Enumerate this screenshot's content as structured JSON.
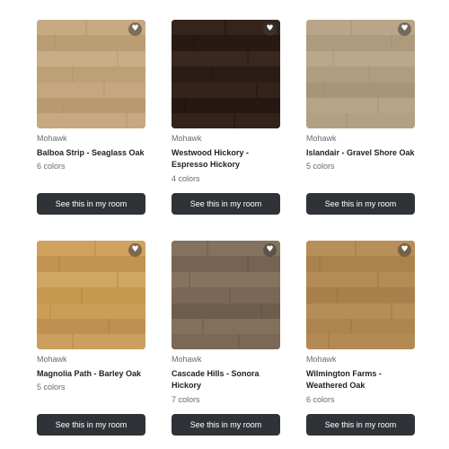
{
  "products": [
    {
      "brand": "Mohawk",
      "name": "Balboa Strip - Seaglass Oak",
      "colors": "6 colors",
      "button_label": "See this in my room",
      "swatch_color": "#c2a57c",
      "favorite_icon": "heart-icon"
    },
    {
      "brand": "Mohawk",
      "name": "Westwood Hickory - Espresso Hickory",
      "colors": "4 colors",
      "button_label": "See this in my room",
      "swatch_color": "#2e1e17",
      "favorite_icon": "heart-icon"
    },
    {
      "brand": "Mohawk",
      "name": "Islandair - Gravel Shore Oak",
      "colors": "5 colors",
      "button_label": "See this in my room",
      "swatch_color": "#b5a184",
      "favorite_icon": "heart-icon"
    },
    {
      "brand": "Mohawk",
      "name": "Magnolia Path - Barley Oak",
      "colors": "5 colors",
      "button_label": "See this in my room",
      "swatch_color": "#c79a55",
      "favorite_icon": "heart-icon"
    },
    {
      "brand": "Mohawk",
      "name": "Cascade Hills - Sonora Hickory",
      "colors": "7 colors",
      "button_label": "See this in my room",
      "swatch_color": "#7d6a58",
      "favorite_icon": "heart-icon"
    },
    {
      "brand": "Mohawk",
      "name": "Wilmington Farms - Weathered Oak",
      "colors": "6 colors",
      "button_label": "See this in my room",
      "swatch_color": "#b18852",
      "favorite_icon": "heart-icon"
    }
  ],
  "colors": {
    "button_bg": "#2f3338",
    "button_text": "#ffffff",
    "muted_text": "#6b6b6b"
  }
}
